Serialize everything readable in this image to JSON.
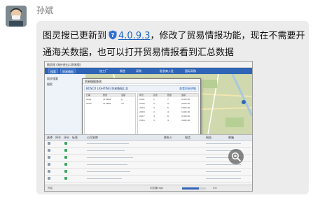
{
  "message": {
    "sender": "孙斌",
    "line1_prefix": "图灵搜已更新到",
    "version": "4.0.9.3",
    "line1_suffix": "，修改了贸易情报功能，现在不需要开",
    "line2": "通海关数据，也可以打开贸易情报看到汇总数据",
    "version_icon": "shield-question-icon"
  },
  "screenshot": {
    "app_title": "图灵搜 (海外进出口贸易版)",
    "toolbar": {
      "buttons": [
        "搜索",
        "贸易情报"
      ],
      "tabs": [
        "加工厂",
        "制造",
        "采购",
        "批发商入驻",
        "国际采购"
      ]
    },
    "left_panel": [
      "同步搜索",
      "搜索"
    ],
    "dialog": {
      "title": "贸易情报查询",
      "company": "BOSCO LIGHTING 贸易情报汇总",
      "link": "查看贸易明细",
      "left_head": [
        "日期",
        "数量",
        "金额"
      ],
      "left_rows": [
        [
          "2021",
          "113894",
          "9"
        ],
        [
          "2020",
          "113894",
          "10"
        ]
      ],
      "right_head": [
        "年份",
        "批次",
        "数量",
        "金额"
      ],
      "right_rows": [
        [
          "2021",
          "1",
          "7",
          "2500.00"
        ],
        [
          "2020",
          "2",
          "9",
          "3000.00"
        ],
        [
          "2019",
          "3",
          "5",
          "1800.00"
        ],
        [
          "2018",
          "2",
          "4",
          "1200.00"
        ],
        [
          "2017",
          "4",
          "6",
          "2100.00"
        ],
        [
          "2016",
          "3",
          "4",
          "1600.00"
        ]
      ]
    },
    "grid_head": [
      "选择",
      "序号",
      "评分",
      "标签",
      "公司名称",
      "联系人",
      "电话",
      "网站",
      "邮箱"
    ],
    "status": {
      "left": "完成",
      "mid": "浏览器Edge",
      "right": "0/0"
    },
    "progress": 0.7
  },
  "colors": {
    "bubble": "#ececec",
    "link": "#1a63c6",
    "toolbar": "#2f64b6"
  }
}
